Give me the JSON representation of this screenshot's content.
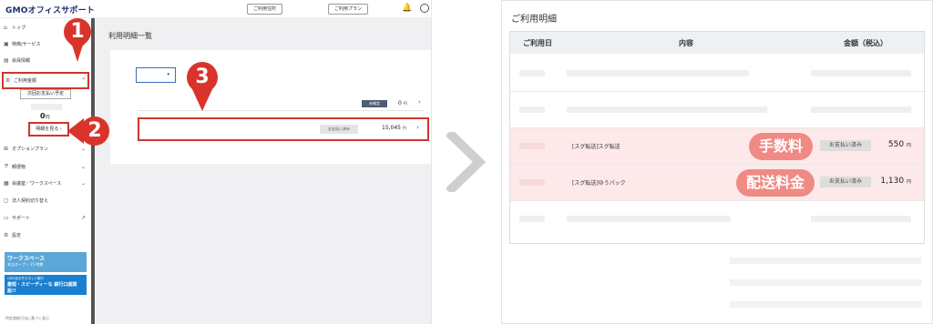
{
  "left": {
    "logo": "GMOオフィスサポート",
    "top_buttons": [
      "ご利用住所",
      "ご利用プラン"
    ],
    "sidebar": {
      "items": [
        {
          "label": "トップ",
          "icon": "home-icon"
        },
        {
          "label": "特典/サービス",
          "icon": "gift-icon"
        },
        {
          "label": "会員情報",
          "icon": "card-icon"
        },
        {
          "label": "ご利用金額",
          "icon": "coin-icon"
        },
        {
          "label": "オプションプラン",
          "icon": "plus-icon"
        },
        {
          "label": "郵便物",
          "icon": "mail-icon"
        },
        {
          "label": "会議室／ワークスペース",
          "icon": "calendar-icon"
        },
        {
          "label": "法人契約切り替え",
          "icon": "document-icon"
        },
        {
          "label": "サポート",
          "icon": "chat-icon"
        },
        {
          "label": "設定",
          "icon": "gear-icon"
        }
      ],
      "next_payment": "次回お支払い予定",
      "amount": "0",
      "amount_unit": "円",
      "detail_button": "明細を見る",
      "banner_workspace": "ワークスペース",
      "banner_workspace_sub": "本当オープン 25 時期",
      "banner_bank_top": "GMOあおぞらネット銀行",
      "banner_bank": "最短・スピーディーな 銀行口座開設!!",
      "footer": "特定商取引法に基づく表示"
    },
    "main": {
      "title": "利用明細一覧",
      "row1_badge": "未確定",
      "row1_amount": "0",
      "row1_unit": "円",
      "row2_badge": "お支払い済み",
      "row2_amount": "15,045",
      "row2_unit": "円",
      "arrow": "›"
    },
    "markers": [
      "1",
      "2",
      "3"
    ]
  },
  "right": {
    "title": "ご利用明細",
    "headers": {
      "date": "ご利用日",
      "content": "内容",
      "amount": "金額（税込）"
    },
    "rows": [
      {
        "content": "[スグ転送]スグ転送",
        "status": "お支払い済み",
        "amount": "550",
        "unit": "円",
        "tag": "手数料"
      },
      {
        "content": "[スグ転送]ゆうパック",
        "status": "お支払い済み",
        "amount": "1,130",
        "unit": "円",
        "tag": "配送料金"
      }
    ]
  },
  "colors": {
    "accent_red": "#d9342b",
    "highlight_pink": "#fde9e9",
    "pill_pink": "#f08a84",
    "nav_blue": "#1a2c6b"
  }
}
